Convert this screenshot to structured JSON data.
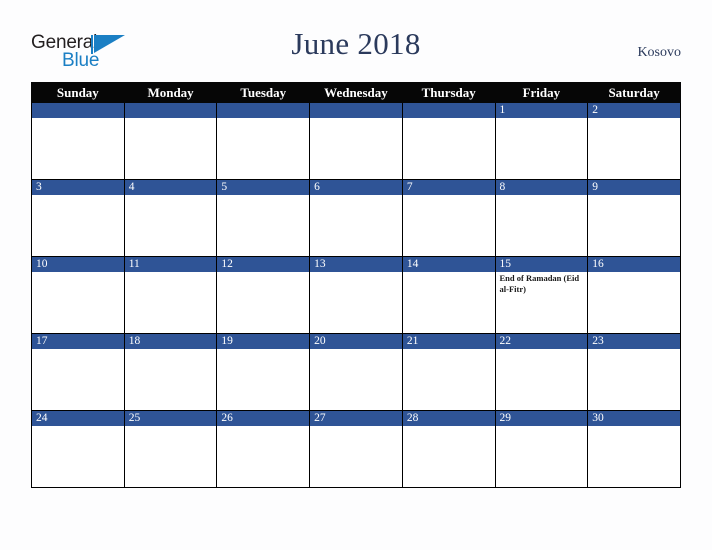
{
  "brand": {
    "name_part1": "General",
    "name_part2": "Blue",
    "flag_icon": "blue-flag-triangle-icon",
    "color_dark": "#231f20",
    "color_blue": "#1b7fc4"
  },
  "header": {
    "title": "June 2018",
    "region": "Kosovo",
    "title_color": "#2b3a5c"
  },
  "calendar": {
    "accent_color": "#2f5496",
    "header_bg": "#060606",
    "weekday_headers": [
      "Sunday",
      "Monday",
      "Tuesday",
      "Wednesday",
      "Thursday",
      "Friday",
      "Saturday"
    ],
    "weeks": [
      [
        {
          "day": "",
          "events": []
        },
        {
          "day": "",
          "events": []
        },
        {
          "day": "",
          "events": []
        },
        {
          "day": "",
          "events": []
        },
        {
          "day": "",
          "events": []
        },
        {
          "day": "1",
          "events": []
        },
        {
          "day": "2",
          "events": []
        }
      ],
      [
        {
          "day": "3",
          "events": []
        },
        {
          "day": "4",
          "events": []
        },
        {
          "day": "5",
          "events": []
        },
        {
          "day": "6",
          "events": []
        },
        {
          "day": "7",
          "events": []
        },
        {
          "day": "8",
          "events": []
        },
        {
          "day": "9",
          "events": []
        }
      ],
      [
        {
          "day": "10",
          "events": []
        },
        {
          "day": "11",
          "events": []
        },
        {
          "day": "12",
          "events": []
        },
        {
          "day": "13",
          "events": []
        },
        {
          "day": "14",
          "events": []
        },
        {
          "day": "15",
          "events": [
            "End of Ramadan (Eid al-Fitr)"
          ]
        },
        {
          "day": "16",
          "events": []
        }
      ],
      [
        {
          "day": "17",
          "events": []
        },
        {
          "day": "18",
          "events": []
        },
        {
          "day": "19",
          "events": []
        },
        {
          "day": "20",
          "events": []
        },
        {
          "day": "21",
          "events": []
        },
        {
          "day": "22",
          "events": []
        },
        {
          "day": "23",
          "events": []
        }
      ],
      [
        {
          "day": "24",
          "events": []
        },
        {
          "day": "25",
          "events": []
        },
        {
          "day": "26",
          "events": []
        },
        {
          "day": "27",
          "events": []
        },
        {
          "day": "28",
          "events": []
        },
        {
          "day": "29",
          "events": []
        },
        {
          "day": "30",
          "events": []
        }
      ]
    ]
  }
}
